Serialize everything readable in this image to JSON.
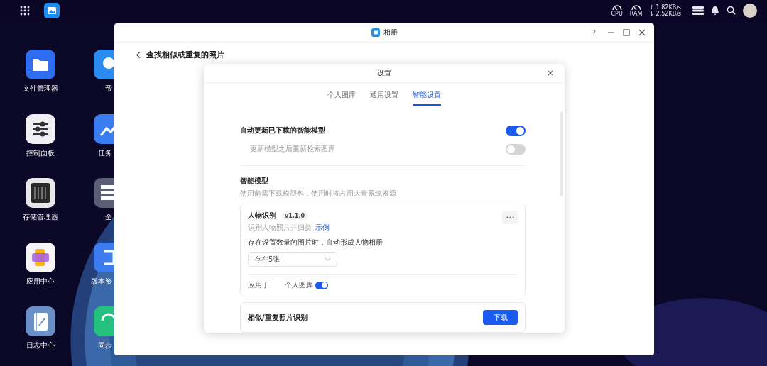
{
  "top_bar": {
    "gauges": [
      "CPU",
      "RAM"
    ],
    "net_up": "↑ 1.82KB/s",
    "net_down": "↓ 2.52KB/s"
  },
  "desktop_icons": [
    {
      "label": "文件管理器",
      "kind": "folder"
    },
    {
      "label": "帮",
      "kind": "help"
    },
    {
      "label": "控制面板",
      "kind": "sliders"
    },
    {
      "label": "任务",
      "kind": "tasks"
    },
    {
      "label": "存储管理器",
      "kind": "storage"
    },
    {
      "label": "全",
      "kind": "global"
    },
    {
      "label": "应用中心",
      "kind": "appcenter"
    },
    {
      "label": "版本资",
      "kind": "version"
    },
    {
      "label": "日志中心",
      "kind": "log"
    },
    {
      "label": "同步",
      "kind": "sync"
    }
  ],
  "window": {
    "title": "相册",
    "help": "?",
    "page_title": "查找相似或重复的照片"
  },
  "dialog": {
    "title": "设置",
    "tabs": [
      {
        "label": "个人图库",
        "selected": false
      },
      {
        "label": "通用设置",
        "selected": false
      },
      {
        "label": "智能设置",
        "selected": true
      }
    ],
    "settings": [
      {
        "label": "自动更新已下载的智能模型",
        "kind": "main",
        "on": true,
        "disabled": false
      },
      {
        "label": "更新模型之后重新检索图库",
        "kind": "sub",
        "on": false,
        "disabled": true
      }
    ],
    "section": {
      "title": "智能模型",
      "description": "使用前需下载模型包，使用时将占用大量系统资源"
    },
    "models": [
      {
        "kind": "installed",
        "name": "人物识别",
        "version": "v1.1.0",
        "description": "识别人物照片并归类",
        "link": "示例",
        "option_label": "存在设置数量的图片时，自动形成人物相册",
        "select_value": "存在5张",
        "apply_label": "应用于",
        "apply_target": "个人图库",
        "apply_on": true
      },
      {
        "kind": "download",
        "name": "相似/重复照片识别",
        "button": "下载"
      }
    ]
  }
}
